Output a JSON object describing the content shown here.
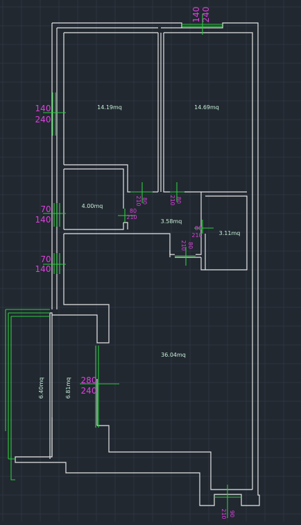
{
  "colors": {
    "background": "#212830",
    "grid": "#2d3540",
    "walls": "#e6e6e6",
    "openings": "#2ecc40",
    "dimensions": "#e040e0",
    "area_labels": "#c8f0d8"
  },
  "areas": {
    "room_top_left": "14.19mq",
    "room_top_right": "14.69mq",
    "room_small": "4.00mq",
    "corridor": "3.58mq",
    "room_right_small": "3.11mq",
    "living": "36.04mq",
    "balcony": "6.40mq",
    "room_left_strip": "6.81mq"
  },
  "dimensions": {
    "window_top": {
      "w": "140",
      "h": "240"
    },
    "window_left_upper": {
      "w": "140",
      "h": "240"
    },
    "window_left_small_1": {
      "w": "70",
      "h": "140"
    },
    "window_left_small_2": {
      "w": "70",
      "h": "140"
    },
    "door_1": {
      "w": "80",
      "h": "210"
    },
    "door_2": {
      "w": "80",
      "h": "210"
    },
    "door_3": {
      "w": "80",
      "h": "210"
    },
    "door_4": {
      "w": "80",
      "h": "210"
    },
    "door_5": {
      "w": "80",
      "h": "210"
    },
    "door_entrance": {
      "w": "90",
      "h": "210"
    },
    "slider_door": {
      "w": "280",
      "h": "240"
    }
  }
}
